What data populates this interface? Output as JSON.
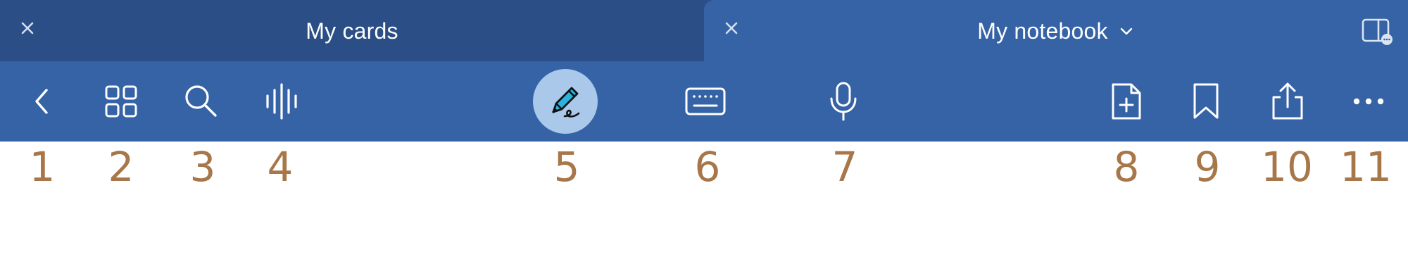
{
  "tabs": [
    {
      "title": "My cards",
      "active": false,
      "close_icon": "close-icon"
    },
    {
      "title": "My notebook",
      "active": true,
      "close_icon": "close-icon",
      "dropdown_icon": "chevron-down-icon"
    }
  ],
  "tabbar": {
    "split_view_icon": "split-view-icon"
  },
  "toolbar": {
    "buttons": [
      {
        "icon": "back-icon"
      },
      {
        "icon": "grid-icon"
      },
      {
        "icon": "search-icon"
      },
      {
        "icon": "audio-waveform-icon"
      },
      {
        "icon": "pen-icon",
        "selected": true
      },
      {
        "icon": "keyboard-icon"
      },
      {
        "icon": "microphone-icon"
      },
      {
        "icon": "add-page-icon"
      },
      {
        "icon": "bookmark-icon"
      },
      {
        "icon": "share-icon"
      },
      {
        "icon": "more-icon"
      }
    ]
  },
  "labels": [
    "1",
    "2",
    "3",
    "4",
    "5",
    "6",
    "7",
    "8",
    "9",
    "10",
    "11"
  ],
  "colors": {
    "tab_inactive": "#2a4e85",
    "tab_active": "#3563a5",
    "toolbar": "#3563a5",
    "pen_highlight": "#a9c8ea",
    "pen_body": "#2bb3e0",
    "label_text": "#a7774a"
  }
}
